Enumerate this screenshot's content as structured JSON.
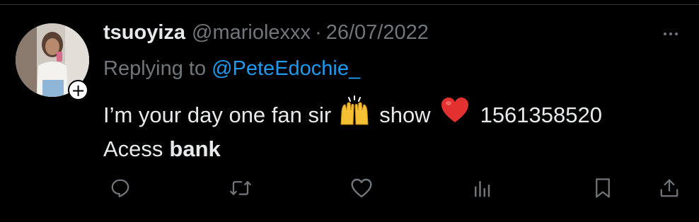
{
  "tweet": {
    "display_name": "tsuoyiza",
    "handle": "@mariolexxx",
    "separator": "·",
    "date": "26/07/2022",
    "replying_prefix": "Replying to",
    "replying_to": "@PeteEdochie_",
    "body": {
      "part1": "I’m your day one fan sir",
      "emoji1": "raising-hands-emoji",
      "part2": "show",
      "emoji2": "red-heart-emoji",
      "part3": "1561358520",
      "line2_normal": "Acess",
      "line2_bold": "bank"
    },
    "follow_symbol": "+"
  },
  "actions": [
    {
      "name": "reply-icon"
    },
    {
      "name": "retweet-icon"
    },
    {
      "name": "like-icon"
    },
    {
      "name": "views-icon"
    },
    {
      "name": "bookmark-icon"
    },
    {
      "name": "share-icon"
    }
  ],
  "colors": {
    "background": "#000000",
    "text_primary": "#e7e9ea",
    "text_secondary": "#71767b",
    "link": "#1d9bf0"
  }
}
